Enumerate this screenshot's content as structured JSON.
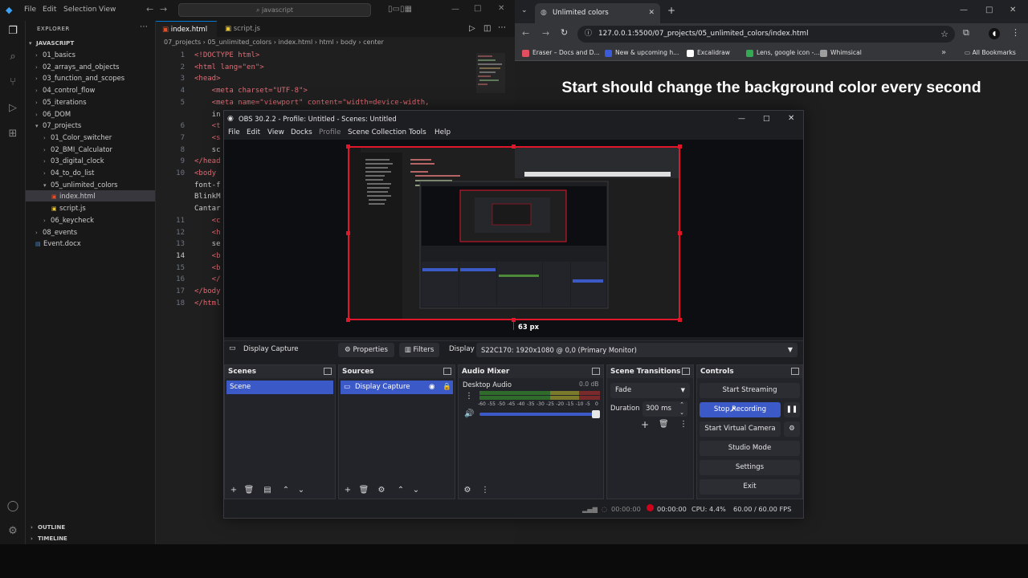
{
  "vscode": {
    "menu": [
      "File",
      "Edit",
      "Selection",
      "View"
    ],
    "search_placeholder": "javascript",
    "explorer_title": "EXPLORER",
    "folder": "JAVASCRIPT",
    "tree": [
      {
        "label": "01_basics",
        "kind": "folder",
        "indent": 0,
        "open": false
      },
      {
        "label": "02_arrays_and_objects",
        "kind": "folder",
        "indent": 0,
        "open": false
      },
      {
        "label": "03_function_and_scopes",
        "kind": "folder",
        "indent": 0,
        "open": false
      },
      {
        "label": "04_control_flow",
        "kind": "folder",
        "indent": 0,
        "open": false
      },
      {
        "label": "05_iterations",
        "kind": "folder",
        "indent": 0,
        "open": false
      },
      {
        "label": "06_DOM",
        "kind": "folder",
        "indent": 0,
        "open": false
      },
      {
        "label": "07_projects",
        "kind": "folder",
        "indent": 0,
        "open": true
      },
      {
        "label": "01_Color_switcher",
        "kind": "folder",
        "indent": 1,
        "open": false
      },
      {
        "label": "02_BMI_Calculator",
        "kind": "folder",
        "indent": 1,
        "open": false
      },
      {
        "label": "03_digital_clock",
        "kind": "folder",
        "indent": 1,
        "open": false
      },
      {
        "label": "04_to_do_list",
        "kind": "folder",
        "indent": 1,
        "open": false
      },
      {
        "label": "05_unlimited_colors",
        "kind": "folder",
        "indent": 1,
        "open": true
      },
      {
        "label": "index.html",
        "kind": "html",
        "indent": 2,
        "selected": true
      },
      {
        "label": "script.js",
        "kind": "js",
        "indent": 2
      },
      {
        "label": "06_keycheck",
        "kind": "folder",
        "indent": 1,
        "open": false
      },
      {
        "label": "08_events",
        "kind": "folder",
        "indent": 0,
        "open": false
      },
      {
        "label": "Event.docx",
        "kind": "doc",
        "indent": 0
      }
    ],
    "outline_label": "OUTLINE",
    "timeline_label": "TIMELINE",
    "tabs": [
      {
        "label": "index.html",
        "active": true
      },
      {
        "label": "script.js",
        "active": false
      }
    ],
    "breadcrumb": [
      "07_projects",
      "05_unlimited_colors",
      "index.html",
      "html",
      "body",
      "center"
    ],
    "code_lines": [
      {
        "n": "1",
        "text": "<!DOCTYPE html>"
      },
      {
        "n": "2",
        "text": "<html lang=\"en\">"
      },
      {
        "n": "3",
        "text": "<head>"
      },
      {
        "n": "4",
        "text": "    <meta charset=\"UTF-8\">"
      },
      {
        "n": "5",
        "text": "    <meta name=\"viewport\" content=\"width=device-width,"
      },
      {
        "n": "",
        "text": "    in"
      },
      {
        "n": "6",
        "text": "    <t"
      },
      {
        "n": "7",
        "text": "    <s"
      },
      {
        "n": "8",
        "text": "    sc"
      },
      {
        "n": "9",
        "text": "</head"
      },
      {
        "n": "10",
        "text": "<body"
      },
      {
        "n": "",
        "text": "font-f"
      },
      {
        "n": "",
        "text": "BlinkM"
      },
      {
        "n": "",
        "text": "Cantar"
      },
      {
        "n": "11",
        "text": "    <c"
      },
      {
        "n": "12",
        "text": "    <h"
      },
      {
        "n": "13",
        "text": "    se"
      },
      {
        "n": "14",
        "text": "    <b"
      },
      {
        "n": "15",
        "text": "    <b"
      },
      {
        "n": "16",
        "text": "    </"
      },
      {
        "n": "17",
        "text": "</body"
      },
      {
        "n": "18",
        "text": "</html"
      }
    ]
  },
  "chrome": {
    "tab_title": "Unlimited colors",
    "url": "127.0.0.1:5500/07_projects/05_unlimited_colors/index.html",
    "bookmarks": [
      {
        "label": "Eraser – Docs and D...",
        "color": "#e04f5f"
      },
      {
        "label": "New & upcoming h...",
        "color": "#3b5bdb"
      },
      {
        "label": "Excalidraw",
        "color": "#ffffff"
      },
      {
        "label": "Lens, google icon -...",
        "color": "#34a853"
      },
      {
        "label": "Whimsical",
        "color": "#9e9e9e"
      }
    ],
    "all_bookmarks": "All Bookmarks",
    "heading": "Start should change the background color every second"
  },
  "obs": {
    "title": "OBS 30.2.2 - Profile: Untitled - Scenes: Untitled",
    "menu": [
      "File",
      "Edit",
      "View",
      "Docks",
      "Profile",
      "Scene Collection",
      "Tools",
      "Help"
    ],
    "preview_label": "63 px",
    "source_name": "Display Capture",
    "properties_label": "Properties",
    "filters_label": "Filters",
    "display_label": "Display",
    "display_value": "S22C170: 1920x1080 @ 0,0 (Primary Monitor)",
    "docks": {
      "scenes": {
        "title": "Scenes",
        "items": [
          "Scene"
        ]
      },
      "sources": {
        "title": "Sources",
        "items": [
          "Display Capture"
        ]
      },
      "mixer": {
        "title": "Audio Mixer",
        "channel": "Desktop Audio",
        "level": "0.0 dB",
        "scale": [
          "-60",
          "-55",
          "-50",
          "-45",
          "-40",
          "-35",
          "-30",
          "-25",
          "-20",
          "-15",
          "-10",
          "-5",
          "0"
        ]
      },
      "transitions": {
        "title": "Scene Transitions",
        "transition": "Fade",
        "duration_label": "Duration",
        "duration_value": "300 ms"
      },
      "controls": {
        "title": "Controls",
        "start_streaming": "Start Streaming",
        "stop_recording": "Stop Recording",
        "start_virtual_camera": "Start Virtual Camera",
        "studio_mode": "Studio Mode",
        "settings": "Settings",
        "exit": "Exit"
      }
    },
    "status": {
      "stream_time": "00:00:00",
      "record_time": "00:00:00",
      "cpu": "CPU: 4.4%",
      "fps": "60.00 / 60.00 FPS"
    },
    "colors": {
      "accent": "#3c59c8",
      "capture_border": "#e0162b"
    }
  }
}
